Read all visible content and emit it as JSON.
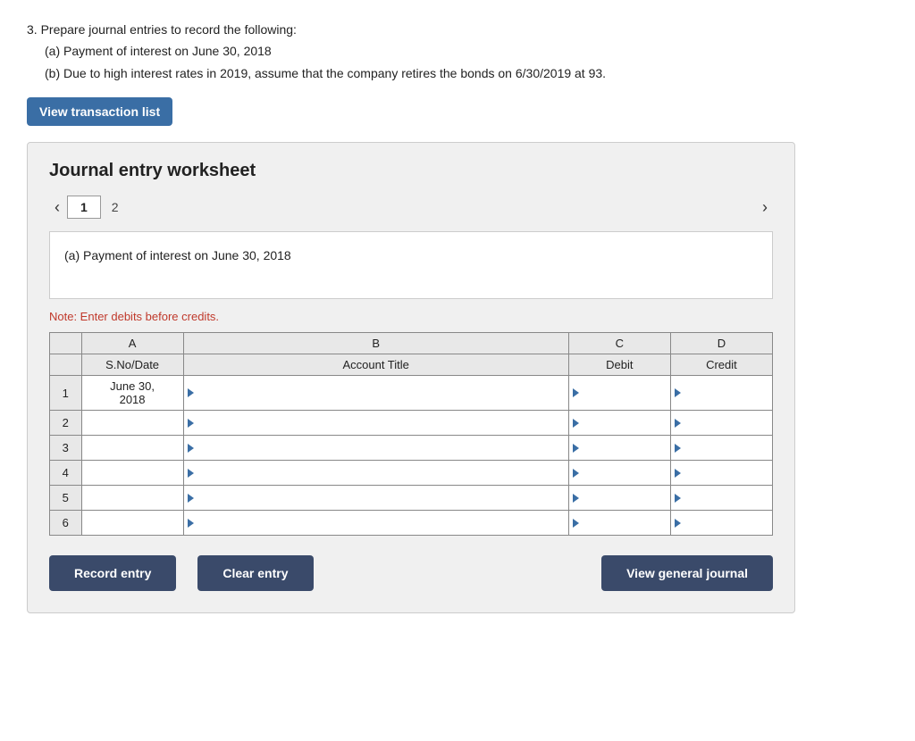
{
  "instructions": {
    "line1": "3. Prepare journal entries to record the following:",
    "line2": "(a) Payment of interest on June 30, 2018",
    "line3": "(b) Due to high interest rates in 2019, assume that the company retires the bonds on 6/30/2019 at 93."
  },
  "viewTransactionBtn": "View transaction list",
  "worksheet": {
    "title": "Journal entry worksheet",
    "tabs": [
      {
        "label": "1",
        "active": true
      },
      {
        "label": "2",
        "active": false
      }
    ],
    "description": "(a) Payment of interest on June 30, 2018",
    "note": "Note: Enter debits before credits.",
    "table": {
      "colHeaders": [
        "A",
        "B",
        "C",
        "D"
      ],
      "subHeaders": [
        "S.No/Date",
        "Account Title",
        "Debit",
        "Credit"
      ],
      "rows": [
        {
          "num": "1",
          "date": "June 30,\n2018",
          "account": "",
          "debit": "",
          "credit": ""
        },
        {
          "num": "2",
          "date": "",
          "account": "",
          "debit": "",
          "credit": ""
        },
        {
          "num": "3",
          "date": "",
          "account": "",
          "debit": "",
          "credit": ""
        },
        {
          "num": "4",
          "date": "",
          "account": "",
          "debit": "",
          "credit": ""
        },
        {
          "num": "5",
          "date": "",
          "account": "",
          "debit": "",
          "credit": ""
        },
        {
          "num": "6",
          "date": "",
          "account": "",
          "debit": "",
          "credit": ""
        }
      ]
    }
  },
  "buttons": {
    "record": "Record entry",
    "clear": "Clear entry",
    "viewGeneral": "View general journal"
  }
}
